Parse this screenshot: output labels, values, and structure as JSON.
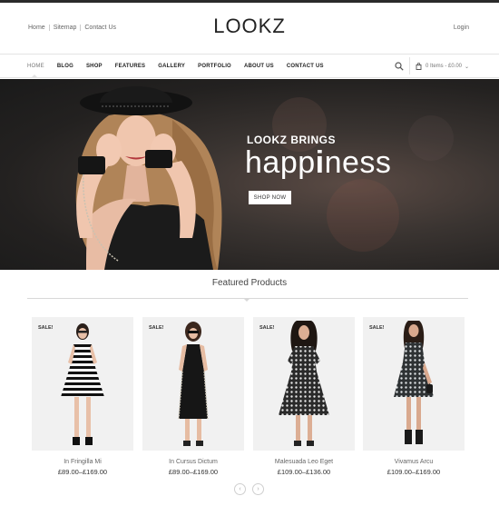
{
  "header": {
    "toplinks": [
      "Home",
      "Sitemap",
      "Contact Us"
    ],
    "logo": "LOOKZ",
    "login": "Login"
  },
  "nav": {
    "items": [
      "HOME",
      "BLOG",
      "SHOP",
      "FEATURES",
      "GALLERY",
      "PORTFOLIO",
      "ABOUT US",
      "CONTACT US"
    ],
    "active": "HOME",
    "cart_label": "0 Items - £0.00",
    "cart_chevron": "⌄"
  },
  "hero": {
    "subtitle": "LOOKZ BRINGS",
    "title_part1": "happ",
    "title_part2": "i",
    "title_part3": "ness",
    "button": "SHOP NOW"
  },
  "featured": {
    "title": "Featured Products"
  },
  "products": [
    {
      "badge": "SALE!",
      "name": "In Fringilla Mi",
      "price": "£89.00–£169.00",
      "dress": "stripe"
    },
    {
      "badge": "SALE!",
      "name": "In Cursus Dictum",
      "price": "£89.00–£169.00",
      "dress": "black"
    },
    {
      "badge": "SALE!",
      "name": "Malesuada Leo Eget",
      "price": "£109.00–£136.00",
      "dress": "floral"
    },
    {
      "badge": "SALE!",
      "name": "Vivamus Arcu",
      "price": "£109.00–£169.00",
      "dress": "floral"
    }
  ],
  "pager": {
    "prev": "‹",
    "next": "›"
  },
  "colors": {
    "accent": "#222222",
    "hero_bg": "#2a2624",
    "card_bg": "#f1f1f1"
  }
}
